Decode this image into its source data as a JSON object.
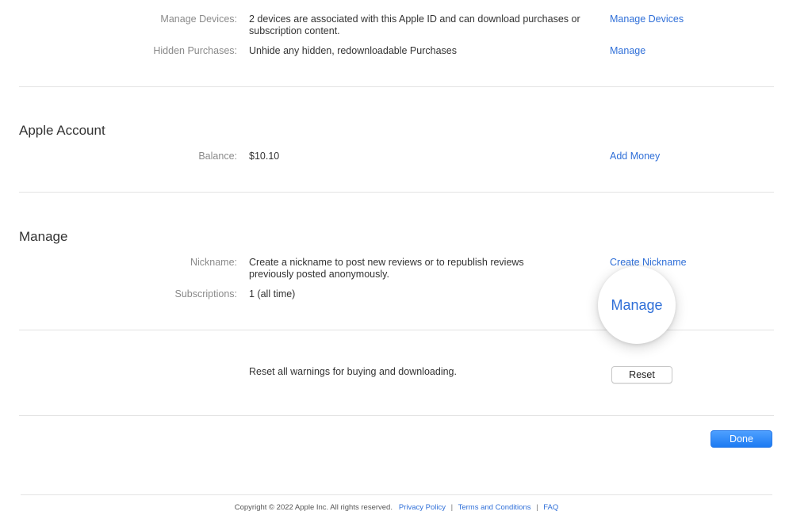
{
  "top_rows": {
    "manage_devices": {
      "label": "Manage Devices:",
      "value": "2 devices are associated with this Apple ID and can download purchases or subscription content.",
      "action": "Manage Devices"
    },
    "hidden_purchases": {
      "label": "Hidden Purchases:",
      "value": "Unhide any hidden, redownloadable Purchases",
      "action": "Manage"
    }
  },
  "apple_account": {
    "heading": "Apple Account",
    "balance": {
      "label": "Balance:",
      "value": "$10.10",
      "action": "Add Money"
    }
  },
  "manage_section": {
    "heading": "Manage",
    "nickname": {
      "label": "Nickname:",
      "value": "Create a nickname to post new reviews or to republish reviews previously posted anonymously.",
      "action": "Create Nickname"
    },
    "subscriptions": {
      "label": "Subscriptions:",
      "value": "1 (all time)",
      "action": "Manage"
    }
  },
  "reset": {
    "text": "Reset all warnings for buying and downloading.",
    "button": "Reset"
  },
  "done_button": "Done",
  "footer": {
    "copyright": "Copyright © 2022 Apple Inc. All rights reserved.",
    "privacy": "Privacy Policy",
    "terms": "Terms and Conditions",
    "faq": "FAQ",
    "separator": "|"
  },
  "colors": {
    "link": "#2f6fd8",
    "done_button": "#1c7af2",
    "label": "#8a8a8a",
    "divider": "#e3e3e3"
  }
}
